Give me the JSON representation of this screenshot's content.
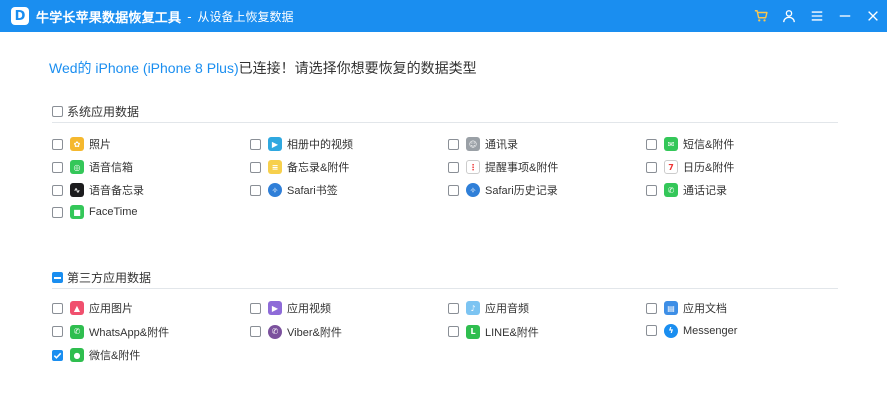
{
  "titlebar": {
    "logo_letter": "D",
    "app_title": "牛学长苹果数据恢复工具",
    "separator": "-",
    "subtitle": "从设备上恢复数据",
    "icons": [
      "cart-icon",
      "user-icon",
      "menu-icon",
      "minimize-icon",
      "close-icon"
    ]
  },
  "heading": {
    "device": "Wed的 iPhone (iPhone 8 Plus)",
    "text": "已连接！请选择你想要恢复的数据类型"
  },
  "system": {
    "title": "系统应用数据",
    "checked": false,
    "items": [
      {
        "label": "照片",
        "icon": "photos-icon",
        "color": "#f5b82e",
        "glyph": "✿",
        "checked": false
      },
      {
        "label": "相册中的视频",
        "icon": "video-icon",
        "color": "#2fa8e0",
        "glyph": "▶",
        "checked": false
      },
      {
        "label": "通讯录",
        "icon": "contacts-icon",
        "color": "#9aa0a6",
        "glyph": "☺",
        "checked": false
      },
      {
        "label": "短信&附件",
        "icon": "messages-icon",
        "color": "#34c759",
        "glyph": "✉",
        "checked": false
      },
      {
        "label": "语音信箱",
        "icon": "voicemail-icon",
        "color": "#34c759",
        "glyph": "◎",
        "checked": false
      },
      {
        "label": "备忘录&附件",
        "icon": "notes-icon",
        "color": "#f7d04c",
        "glyph": "≡",
        "checked": false
      },
      {
        "label": "提醒事项&附件",
        "icon": "reminders-icon",
        "color": "#ffffff",
        "glyph": "⋮",
        "checked": false
      },
      {
        "label": "日历&附件",
        "icon": "calendar-icon",
        "color": "#ffffff",
        "glyph": "7",
        "checked": false
      },
      {
        "label": "语音备忘录",
        "icon": "voice-memos-icon",
        "color": "#1c1c1e",
        "glyph": "∿",
        "checked": false
      },
      {
        "label": "Safari书签",
        "icon": "safari-icon",
        "color": "#2f7fd8",
        "glyph": "✧",
        "checked": false
      },
      {
        "label": "Safari历史记录",
        "icon": "safari-history-icon",
        "color": "#2f7fd8",
        "glyph": "✧",
        "checked": false
      },
      {
        "label": "通话记录",
        "icon": "phone-icon",
        "color": "#34c759",
        "glyph": "✆",
        "checked": false
      },
      {
        "label": "FaceTime",
        "icon": "facetime-icon",
        "color": "#34c759",
        "glyph": "■",
        "checked": false
      }
    ]
  },
  "third_party": {
    "title": "第三方应用数据",
    "checked": "partial",
    "items": [
      {
        "label": "应用图片",
        "icon": "app-photos-icon",
        "color": "#f0506e",
        "glyph": "▲",
        "checked": false
      },
      {
        "label": "应用视频",
        "icon": "app-video-icon",
        "color": "#8e6bd8",
        "glyph": "▶",
        "checked": false
      },
      {
        "label": "应用音频",
        "icon": "app-audio-icon",
        "color": "#7cc4f2",
        "glyph": "♪",
        "checked": false
      },
      {
        "label": "应用文档",
        "icon": "app-docs-icon",
        "color": "#3d8ee6",
        "glyph": "▤",
        "checked": false
      },
      {
        "label": "WhatsApp&附件",
        "icon": "whatsapp-icon",
        "color": "#2fbe4f",
        "glyph": "✆",
        "checked": false
      },
      {
        "label": "Viber&附件",
        "icon": "viber-icon",
        "color": "#7b519d",
        "glyph": "✆",
        "checked": false
      },
      {
        "label": "LINE&附件",
        "icon": "line-icon",
        "color": "#2fbe4f",
        "glyph": "L",
        "checked": false
      },
      {
        "label": "Messenger",
        "icon": "messenger-icon",
        "color": "#1a8ef0",
        "glyph": "ϟ",
        "checked": false
      },
      {
        "label": "微信&附件",
        "icon": "wechat-icon",
        "color": "#2fbe4f",
        "glyph": "●",
        "checked": true
      }
    ]
  },
  "colors": {
    "accent": "#1a8ef0",
    "text": "#333333",
    "divider": "#e2e6ea"
  }
}
